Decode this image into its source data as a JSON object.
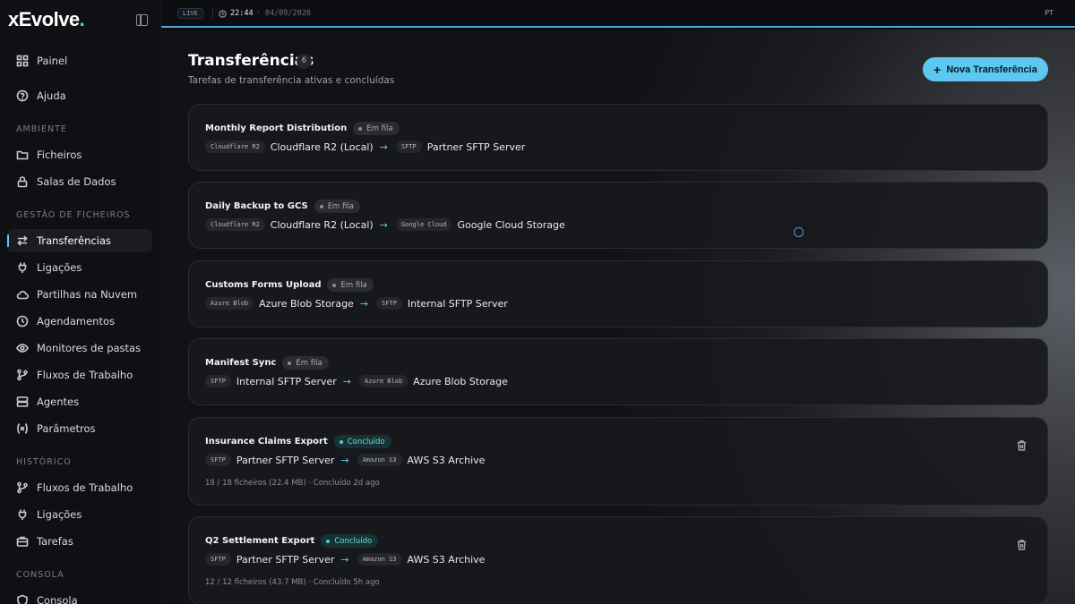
{
  "app": {
    "logo_text": "xEvolve",
    "logo_dot": ".",
    "accent_color": "#5cc8f0"
  },
  "topbar": {
    "live_label": "LIVE",
    "time": "22:44",
    "date": "· 04/09/2026",
    "language": "PT"
  },
  "sidebar": {
    "top_items": [
      {
        "label": "Painel",
        "icon": "grid-icon"
      },
      {
        "label": "Ajuda",
        "icon": "help-circle-icon"
      }
    ],
    "sections": [
      {
        "label": "AMBIENTE",
        "items": [
          {
            "label": "Ficheiros",
            "icon": "folder-icon"
          },
          {
            "label": "Salas de Dados",
            "icon": "lock-icon"
          }
        ]
      },
      {
        "label": "GESTÃO DE FICHEIROS",
        "items": [
          {
            "label": "Transferências",
            "icon": "transfer-arrows-icon",
            "active": true
          },
          {
            "label": "Ligações",
            "icon": "plug-icon"
          },
          {
            "label": "Partilhas na Nuvem",
            "icon": "cloud-icon"
          },
          {
            "label": "Agendamentos",
            "icon": "clock-icon"
          },
          {
            "label": "Monitores de pastas",
            "icon": "eye-icon"
          },
          {
            "label": "Fluxos de Trabalho",
            "icon": "git-branch-icon"
          },
          {
            "label": "Agentes",
            "icon": "server-icon"
          },
          {
            "label": "Parâmetros",
            "icon": "variable-icon"
          }
        ]
      },
      {
        "label": "HISTÓRICO",
        "items": [
          {
            "label": "Fluxos de Trabalho",
            "icon": "git-branch-icon"
          },
          {
            "label": "Ligações",
            "icon": "plug-icon"
          },
          {
            "label": "Tarefas",
            "icon": "briefcase-icon"
          }
        ]
      },
      {
        "label": "CONSOLA",
        "items": [
          {
            "label": "Consola",
            "icon": "shield-icon"
          }
        ]
      }
    ]
  },
  "main": {
    "title": "Transferências",
    "count": "6",
    "subtitle": "Tarefas de transferência ativas e concluídas",
    "new_button_label": "Nova Transferência",
    "transfers": [
      {
        "name": "Monthly Report Distribution",
        "status": "Em fila",
        "status_type": "queued",
        "src_tag": "Cloudflare R2",
        "src": "Cloudflare R2 (Local)",
        "dst_tag": "SFTP",
        "dst": "Partner SFTP Server"
      },
      {
        "name": "Daily Backup to GCS",
        "status": "Em fila",
        "status_type": "queued",
        "src_tag": "Cloudflare R2",
        "src": "Cloudflare R2 (Local)",
        "dst_tag": "Google Cloud",
        "dst": "Google Cloud Storage"
      },
      {
        "name": "Customs Forms Upload",
        "status": "Em fila",
        "status_type": "queued",
        "src_tag": "Azure Blob",
        "src": "Azure Blob Storage",
        "dst_tag": "SFTP",
        "dst": "Internal SFTP Server"
      },
      {
        "name": "Manifest Sync",
        "status": "Em fila",
        "status_type": "queued",
        "src_tag": "SFTP",
        "src": "Internal SFTP Server",
        "dst_tag": "Azure Blob",
        "dst": "Azure Blob Storage"
      },
      {
        "name": "Insurance Claims Export",
        "status": "Concluído",
        "status_type": "done",
        "src_tag": "SFTP",
        "src": "Partner SFTP Server",
        "dst_tag": "Amazon S3",
        "dst": "AWS S3 Archive",
        "meta": "18 / 18 ficheiros (22.4 MB) · Concluído 2d ago"
      },
      {
        "name": "Q2 Settlement Export",
        "status": "Concluído",
        "status_type": "done",
        "src_tag": "SFTP",
        "src": "Partner SFTP Server",
        "dst_tag": "Amazon S3",
        "dst": "AWS S3 Archive",
        "meta": "12 / 12 ficheiros (43.7 MB) · Concluído 5h ago"
      }
    ]
  }
}
